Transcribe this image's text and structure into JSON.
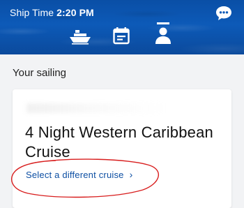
{
  "header": {
    "ship_time_label": "Ship Time",
    "ship_time_value": "2:20 PM",
    "icons": [
      "chat-icon",
      "ship-icon",
      "calendar-icon",
      "person-icon"
    ]
  },
  "main": {
    "section_title": "Your sailing",
    "cruise_title": "4 Night Western Caribbean Cruise",
    "select_link": "Select a different cruise",
    "chevron": "›"
  },
  "colors": {
    "header_blue": "#0d5ab8",
    "link_blue": "#0d4fa3",
    "annotation_red": "#d81e1e"
  }
}
